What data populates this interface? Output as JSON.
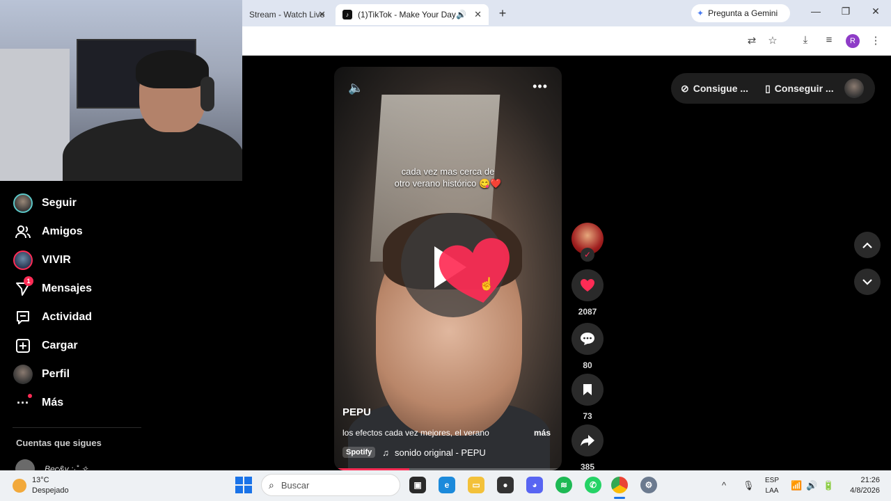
{
  "browser": {
    "tab_inactive_label": "Stream - Watch Live",
    "tab_active_label": "(1)TikTok - Make Your Day",
    "gemini_label": "Pregunta a Gemini",
    "profile_initial": "R"
  },
  "sidebar": {
    "items": [
      {
        "label": "Seguir"
      },
      {
        "label": "Amigos"
      },
      {
        "label": "VIVIR"
      },
      {
        "label": "Mensajes",
        "badge": "1"
      },
      {
        "label": "Actividad"
      },
      {
        "label": "Cargar"
      },
      {
        "label": "Perfil"
      },
      {
        "label": "Más"
      }
    ],
    "following_title": "Cuentas que sigues",
    "following_first": "Bec&y :·˚ ✧"
  },
  "top_actions": {
    "coins_label": "Consigue ...",
    "app_label": "Conseguir ..."
  },
  "video": {
    "overlay_text_line1": "cada vez mas cerca de",
    "overlay_text_line2": "otro verano histórico 😋❤️",
    "author": "PEPU",
    "description": "los efectos cada vez mejores, el verano",
    "more_label": "más",
    "spotify_label": "Spotify",
    "sound_label": "sonido original - PEPU",
    "progress_fraction": 0.33
  },
  "actions": {
    "likes": "2087",
    "comments": "80",
    "saves": "73",
    "shares": "385"
  },
  "taskbar": {
    "temperature": "13°C",
    "weather": "Despejado",
    "search_placeholder": "Buscar",
    "lang_line1": "ESP",
    "lang_line2": "LAA",
    "time": "21:26",
    "date": "4/8/2026"
  },
  "colors": {
    "accent": "#fe2c55",
    "background": "#000000",
    "windows_blue": "#1a73e8"
  }
}
